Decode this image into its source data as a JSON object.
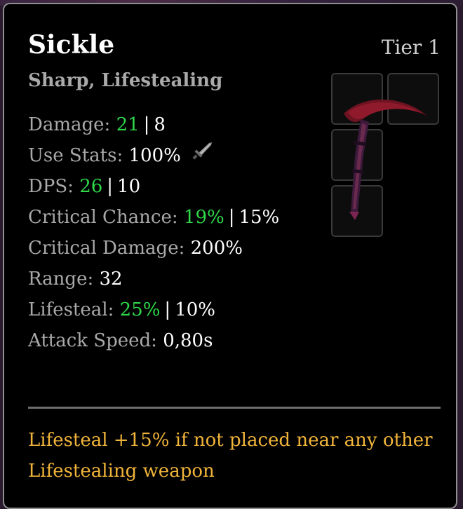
{
  "item": {
    "name": "Sickle",
    "tier": "Tier 1",
    "tags": "Sharp, Lifestealing"
  },
  "stats": {
    "damage": {
      "label": "Damage:",
      "value": "21",
      "base": "8"
    },
    "use_stats": {
      "label": "Use Stats:",
      "value": "100%",
      "icon": "sword-icon"
    },
    "dps": {
      "label": "DPS:",
      "value": "26",
      "base": "10"
    },
    "crit_chance": {
      "label": "Critical Chance:",
      "value": "19%",
      "base": "15%"
    },
    "crit_damage": {
      "label": "Critical Damage:",
      "value": "200%"
    },
    "range": {
      "label": "Range:",
      "value": "32"
    },
    "lifesteal": {
      "label": "Lifesteal:",
      "value": "25%",
      "base": "10%"
    },
    "attack_speed": {
      "label": "Attack Speed:",
      "value": "0,80s"
    }
  },
  "description": {
    "line1": "Lifesteal +15% if not placed near any other",
    "line2": "Lifestealing weapon"
  },
  "colors": {
    "highlight_green": "#2fd84a",
    "description_gold": "#f0b43a",
    "label_gray": "#a9a9a9",
    "background": "#000000"
  },
  "icons": {
    "item_art": "sickle-icon",
    "stat_icon": "sword-icon"
  }
}
